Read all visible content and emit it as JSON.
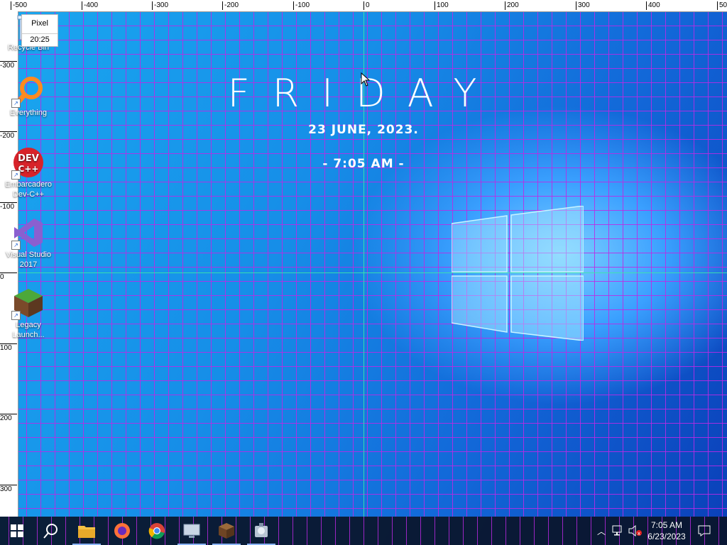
{
  "ruler": {
    "top_ticks": [
      "-500",
      "-400",
      "-300",
      "-200",
      "-100",
      "0",
      "100",
      "200",
      "300",
      "400",
      "50"
    ],
    "left_ticks": [
      "-300",
      "-200",
      "-100",
      "0",
      "100",
      "200",
      "300"
    ]
  },
  "pixel_readout": {
    "label": "Pixel",
    "value": "20:25"
  },
  "desktop_icons": [
    {
      "label": "Recycle Bin"
    },
    {
      "label": "Everything"
    },
    {
      "label": "Embarcadero Dev-C++"
    },
    {
      "label": "Visual Studio 2017"
    },
    {
      "label": "Legacy Launch..."
    }
  ],
  "clock_widget": {
    "day": "FRIDAY",
    "date": "23 JUNE, 2023.",
    "time": "- 7:05 AM -"
  },
  "taskbar": {
    "apps": [
      "start-button",
      "search-button",
      "file-explorer",
      "firefox",
      "chrome",
      "app-monitor",
      "minecraft-launcher",
      "app-tool"
    ],
    "tray_time": "7:05 AM",
    "tray_date": "6/23/2023"
  },
  "colors": {
    "grid": "#be28e6",
    "crosshair": "#3ce6aa",
    "taskbar": "#0a1428"
  }
}
